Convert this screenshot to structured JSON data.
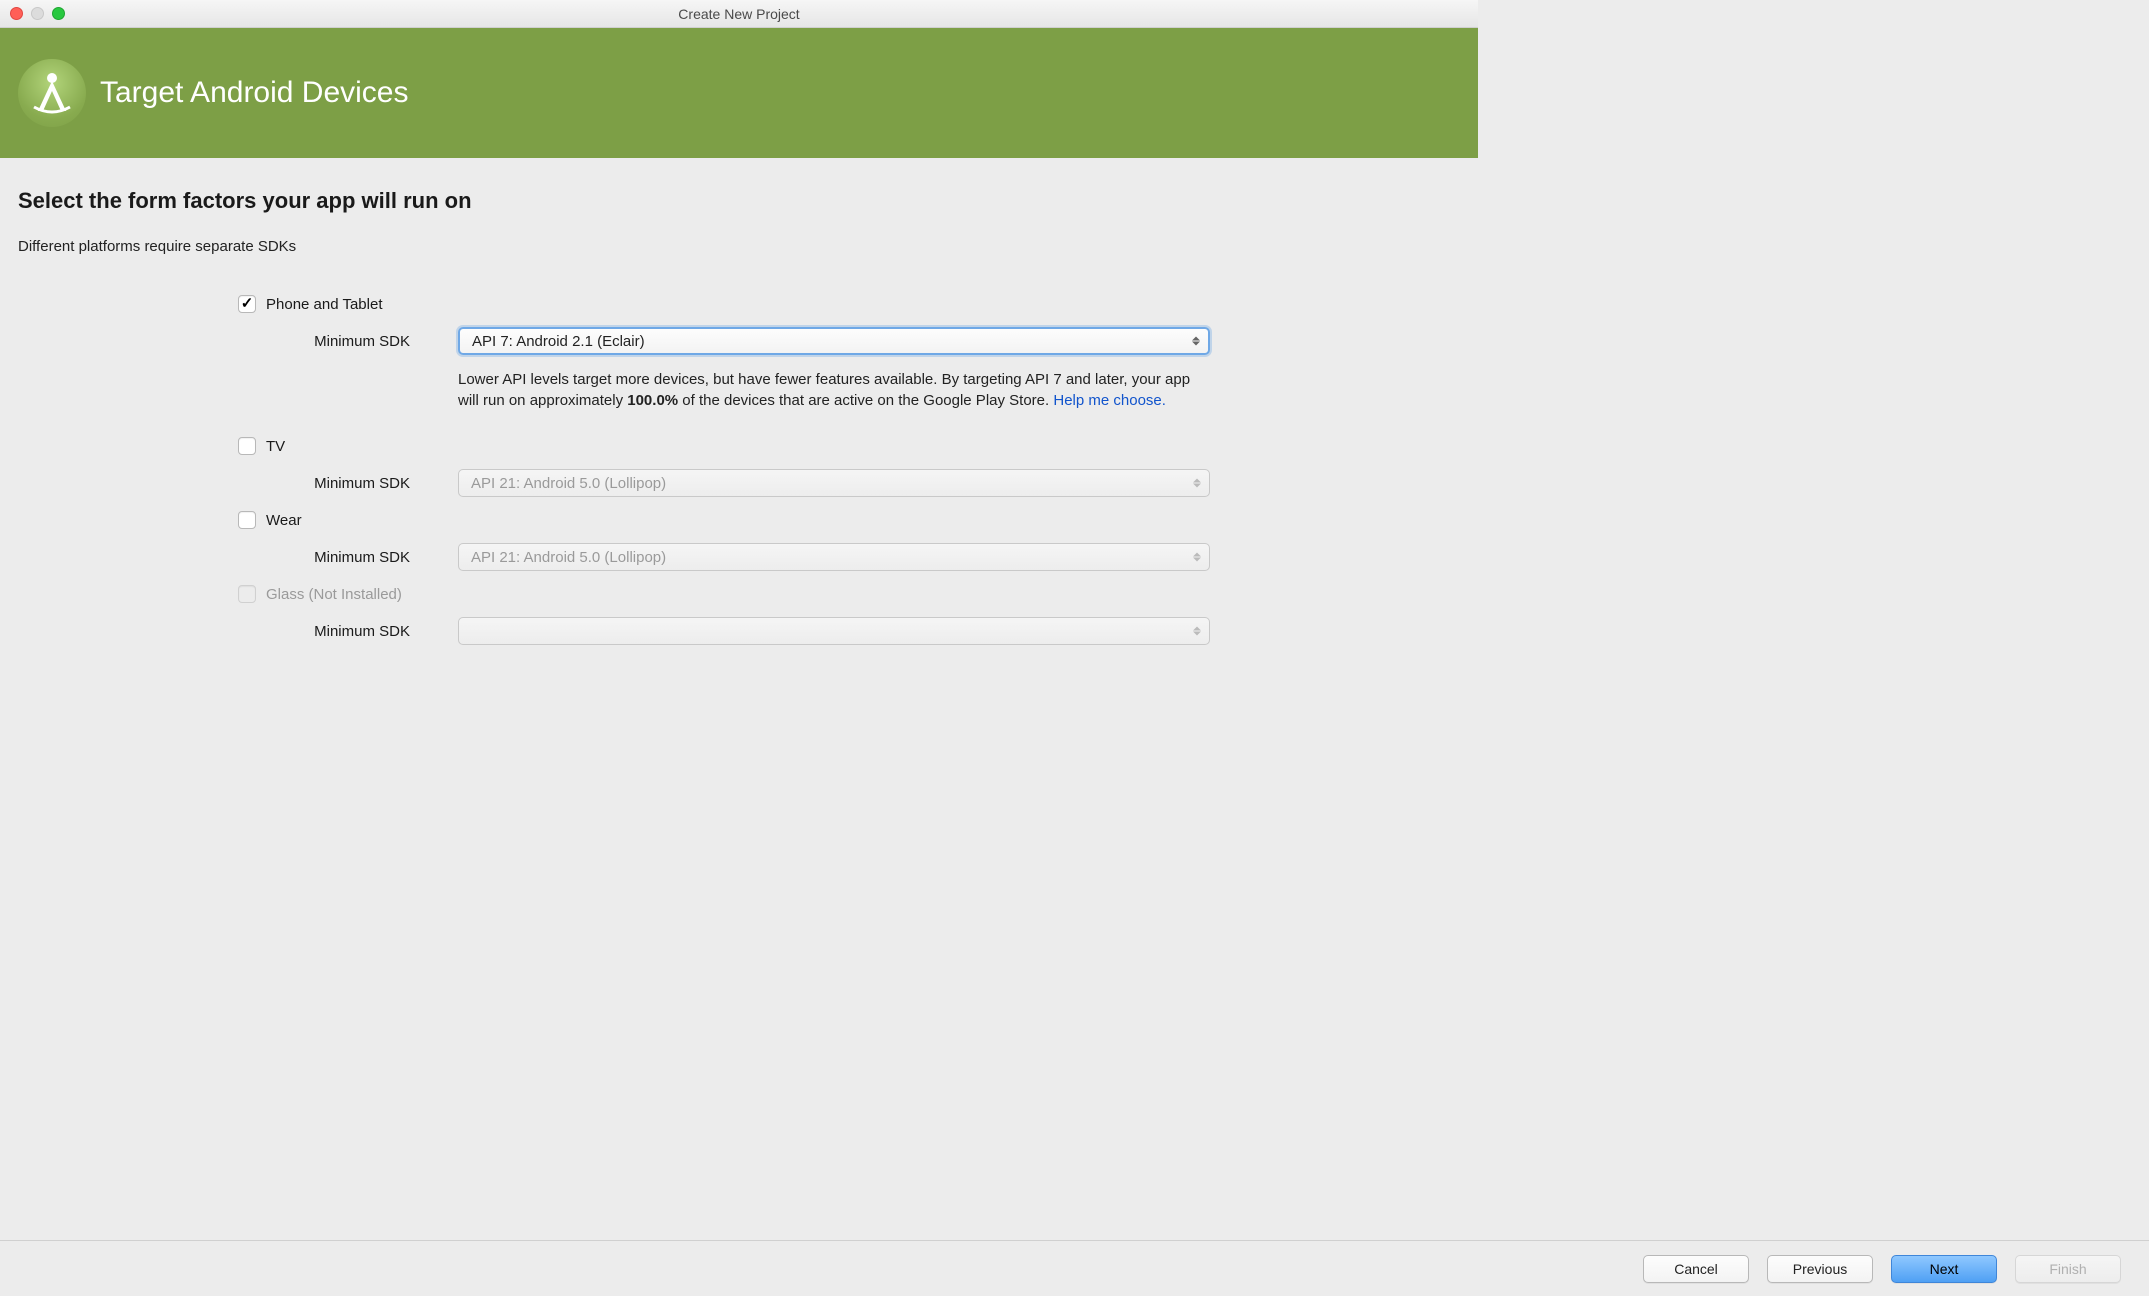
{
  "window": {
    "title": "Create New Project"
  },
  "header": {
    "title": "Target Android Devices"
  },
  "section": {
    "title": "Select the form factors your app will run on",
    "subtitle": "Different platforms require separate SDKs"
  },
  "formFactors": {
    "phone": {
      "label": "Phone and Tablet",
      "sdk_label": "Minimum SDK",
      "sdk_value": "API 7: Android 2.1 (Eclair)"
    },
    "tv": {
      "label": "TV",
      "sdk_label": "Minimum SDK",
      "sdk_value": "API 21: Android 5.0 (Lollipop)"
    },
    "wear": {
      "label": "Wear",
      "sdk_label": "Minimum SDK",
      "sdk_value": "API 21: Android 5.0 (Lollipop)"
    },
    "glass": {
      "label": "Glass (Not Installed)",
      "sdk_label": "Minimum SDK",
      "sdk_value": ""
    }
  },
  "helpText": {
    "part1": "Lower API levels target more devices, but have fewer features available. By targeting API 7 and later, your app will run on approximately ",
    "bold": "100.0%",
    "part2": " of the devices that are active on the Google Play Store. ",
    "link": "Help me choose."
  },
  "footer": {
    "cancel": "Cancel",
    "previous": "Previous",
    "next": "Next",
    "finish": "Finish"
  }
}
